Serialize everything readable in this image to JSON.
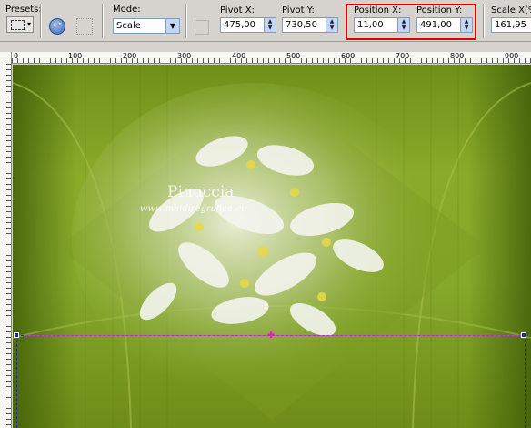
{
  "toolbar": {
    "presets_label": "Presets:",
    "mode_label": "Mode:",
    "mode_value": "Scale",
    "pivot_x_label": "Pivot X:",
    "pivot_x_value": "475,00",
    "pivot_y_label": "Pivot Y:",
    "pivot_y_value": "730,50",
    "position_x_label": "Position X:",
    "position_x_value": "11,00",
    "position_y_label": "Position Y:",
    "position_y_value": "491,00",
    "scale_x_label": "Scale X(%)",
    "scale_x_value": "161,95"
  },
  "ruler": {
    "labels": [
      "0",
      "100",
      "200",
      "300",
      "400",
      "500",
      "600",
      "700",
      "800",
      "900"
    ]
  },
  "canvas": {
    "watermark_title": "Pinuccia",
    "watermark_url": "www.maidiregrafica.eu"
  },
  "colors": {
    "highlight": "#e00000",
    "canvas_green": "#86a82a",
    "guide_pink": "#e040d0"
  }
}
